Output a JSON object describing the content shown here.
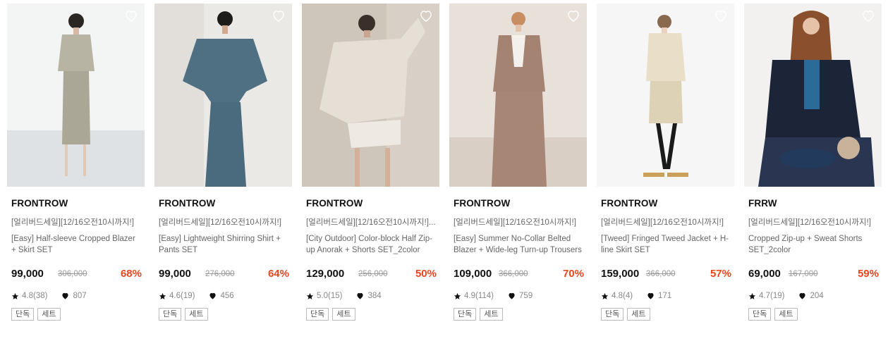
{
  "colors": {
    "discount": "#e8461c",
    "text": "#111111",
    "muted": "#666666",
    "strike": "#999999"
  },
  "products": [
    {
      "brand": "FRONTROW",
      "promo": "[얼리버드세일][12/16오전10시까지!]",
      "name": "[Easy] Half-sleeve Cropped Blazer + Skirt SET",
      "price": "99,000",
      "original_price": "306,000",
      "discount": "68%",
      "rating": "4.8(38)",
      "likes": "807",
      "tags": [
        "단독",
        "세트"
      ],
      "heart_icon": "heart-outline-icon"
    },
    {
      "brand": "FRONTROW",
      "promo": "[얼리버드세일][12/16오전10시까지!]",
      "name": "[Easy] Lightweight Shirring Shirt + Pants SET",
      "price": "99,000",
      "original_price": "276,000",
      "discount": "64%",
      "rating": "4.6(19)",
      "likes": "456",
      "tags": [
        "단독",
        "세트"
      ],
      "heart_icon": "heart-outline-icon"
    },
    {
      "brand": "FRONTROW",
      "promo": "[얼리버드세일][12/16오전10시까지!]...",
      "name": "[City Outdoor] Color-block Half Zip-up Anorak + Shorts SET_2color",
      "price": "129,000",
      "original_price": "256,000",
      "discount": "50%",
      "rating": "5.0(15)",
      "likes": "384",
      "tags": [
        "단독",
        "세트"
      ],
      "heart_icon": "heart-outline-icon"
    },
    {
      "brand": "FRONTROW",
      "promo": "[얼리버드세일][12/16오전10시까지!]",
      "name": "[Easy] Summer No-Collar Belted Blazer + Wide-leg Turn-up Trousers ...",
      "price": "109,000",
      "original_price": "366,000",
      "discount": "70%",
      "rating": "4.9(114)",
      "likes": "759",
      "tags": [
        "단독",
        "세트"
      ],
      "heart_icon": "heart-outline-icon"
    },
    {
      "brand": "FRONTROW",
      "promo": "[얼리버드세일][12/16오전10시까지!]",
      "name": "[Tweed] Fringed Tweed Jacket + H-line Skirt SET",
      "price": "159,000",
      "original_price": "366,000",
      "discount": "57%",
      "rating": "4.8(4)",
      "likes": "171",
      "tags": [
        "단독",
        "세트"
      ],
      "heart_icon": "heart-outline-icon"
    },
    {
      "brand": "FRRW",
      "promo": "[얼리버드세일][12/16오전10시까지!]",
      "name": "Cropped Zip-up + Sweat Shorts SET_2color",
      "price": "69,000",
      "original_price": "167,000",
      "discount": "59%",
      "rating": "4.7(19)",
      "likes": "204",
      "tags": [
        "단독",
        "세트"
      ],
      "heart_icon": "heart-outline-icon"
    }
  ]
}
